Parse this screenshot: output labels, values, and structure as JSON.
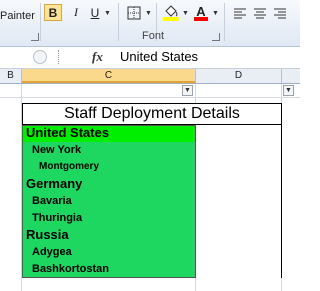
{
  "ribbon": {
    "clipboard_label_partial": "Painter",
    "font_group_label": "Font",
    "bold_label": "B",
    "italic_label": "I",
    "underline_label": "U",
    "font_color_glyph": "A",
    "accent_bold_bg": "#fbe39a",
    "fill_color": "#ffff00",
    "font_color": "#ff0000"
  },
  "formula_bar": {
    "fx_label": "fx",
    "value": "United States"
  },
  "columns": [
    "B",
    "C",
    "D"
  ],
  "sheet": {
    "title": "Staff Deployment Details",
    "rows": [
      {
        "label": "United States",
        "level": 0
      },
      {
        "label": "New York",
        "level": 1
      },
      {
        "label": "Montgomery",
        "level": 2
      },
      {
        "label": "Germany",
        "level": 0
      },
      {
        "label": "Bavaria",
        "level": 1
      },
      {
        "label": "Thuringia",
        "level": 1
      },
      {
        "label": "Russia",
        "level": 0
      },
      {
        "label": "Adygea",
        "level": 1
      },
      {
        "label": "Bashkortostan",
        "level": 1
      }
    ],
    "highlight_color": "#1ed760"
  }
}
